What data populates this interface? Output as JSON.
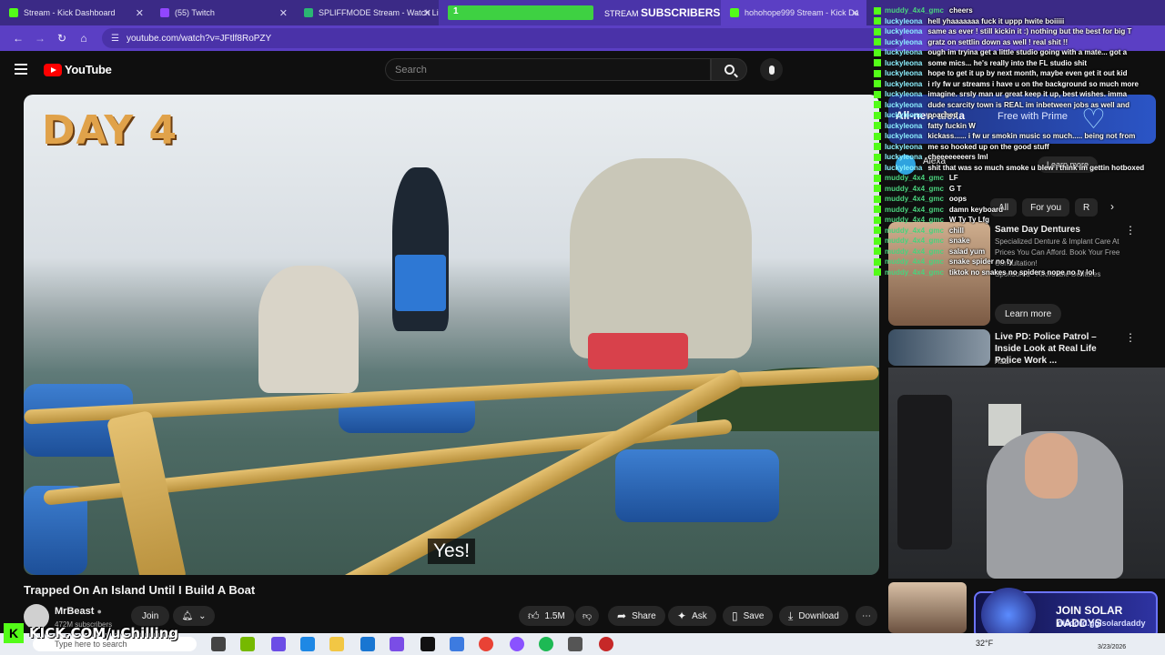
{
  "browser": {
    "tabs": [
      {
        "label": "Stream - Kick Dashboard",
        "icon": "kick-icon"
      },
      {
        "label": "(55) Twitch",
        "icon": "twitch-icon"
      },
      {
        "label": "SPLIFFMODE Stream - Watch Li",
        "icon": "kick-icon"
      },
      {
        "label": "hohohope999 Stream - Kick Da",
        "icon": "kick-icon"
      }
    ],
    "url": "youtube.com/watch?v=JFtlf8RoPZY"
  },
  "youtube": {
    "logo_text": "YouTube",
    "search_placeholder": "Search"
  },
  "video": {
    "overlay_title": "DAY 4",
    "caption": "Yes!",
    "title": "Trapped On An Island Until I Build A Boat",
    "channel": "MrBeast",
    "subscribers": "472M subscribers",
    "join": "Join",
    "likes": "1.5M",
    "actions": {
      "share": "Share",
      "ask": "Ask",
      "save": "Save",
      "download": "Download"
    }
  },
  "sidebar": {
    "ad": {
      "headline": "All-new alexa",
      "tagline": "Free with Prime"
    },
    "alexa_label": "Alexa",
    "alexa_learn": "Learn more",
    "chips": [
      "All",
      "For you",
      "R"
    ],
    "sponsored": {
      "title": "Same Day Dentures",
      "desc": "Specialized Denture & Implant Care At Prices You Can Afford. Book Your Free Consultation!",
      "sponsor": "Sponsored · Affordable Dentures",
      "learn": "Learn more"
    },
    "rec": {
      "title": "Live PD: Police Patrol – Inside Look at Real Life Police Work ...",
      "channel": "A&E"
    }
  },
  "chat": [
    {
      "user": "muddy_4x4_gmc",
      "msg": "cheers",
      "cls": "muddy"
    },
    {
      "user": "luckyleona",
      "msg": "hell yhaaaaaaa fuck it uppp hwite boiiiii",
      "cls": ""
    },
    {
      "user": "luckyleona",
      "msg": "same as ever ! still kickin it :) nothing but the best for big T",
      "cls": ""
    },
    {
      "user": "luckyleona",
      "msg": "gratz on settlin down as well ! real shit !!",
      "cls": ""
    },
    {
      "user": "luckyleona",
      "msg": "ough im tryina get a little studio going with a mate... got a",
      "cls": ""
    },
    {
      "user": "luckyleona",
      "msg": "some mics... he's really into the FL studio shit",
      "cls": ""
    },
    {
      "user": "luckyleona",
      "msg": "hope to get it up by next month, maybe even get it out kid",
      "cls": ""
    },
    {
      "user": "luckyleona",
      "msg": "i rly fw ur streams i have u on the background so much more",
      "cls": ""
    },
    {
      "user": "luckyleona",
      "msg": "imagine. srsly man ur great keep it up, best wishes. imma",
      "cls": ""
    },
    {
      "user": "luckyleona",
      "msg": "dude scarcity town is REAL im inbetween jobs as well and",
      "cls": ""
    },
    {
      "user": "luckyleona",
      "msg": "poached",
      "cls": ""
    },
    {
      "user": "luckyleona",
      "msg": "fatty fuckin W",
      "cls": ""
    },
    {
      "user": "luckyleona",
      "msg": "kickass...... i fw ur smokin music so much..... being not from",
      "cls": ""
    },
    {
      "user": "luckyleona",
      "msg": "me so hooked up on the good stuff",
      "cls": ""
    },
    {
      "user": "luckyleona",
      "msg": "cheeeeeeeers lml",
      "cls": ""
    },
    {
      "user": "luckyleona",
      "msg": "shit that was so much smoke u blew i think im gettin hotboxed",
      "cls": ""
    },
    {
      "user": "muddy_4x4_gmc",
      "msg": "LF",
      "cls": "muddy"
    },
    {
      "user": "muddy_4x4_gmc",
      "msg": "G T",
      "cls": "muddy"
    },
    {
      "user": "muddy_4x4_gmc",
      "msg": "oops",
      "cls": "muddy"
    },
    {
      "user": "muddy_4x4_gmc",
      "msg": "damn keyboard",
      "cls": "muddy"
    },
    {
      "user": "muddy_4x4_gmc",
      "msg": "W Ty Ty Lfg",
      "cls": "muddy"
    },
    {
      "user": "muddy_4x4_gmc",
      "msg": "chill",
      "cls": "muddy"
    },
    {
      "user": "muddy_4x4_gmc",
      "msg": "snake",
      "cls": "muddy"
    },
    {
      "user": "muddy_4x4_gmc",
      "msg": "salad yum",
      "cls": "muddy"
    },
    {
      "user": "muddy_4x4_gmc",
      "msg": "snake spider no ty",
      "cls": "muddy"
    },
    {
      "user": "muddy_4x4_gmc",
      "msg": "tiktok no snakes no spiders nope no ty lol",
      "cls": "muddy"
    }
  ],
  "overlays": {
    "sub_count": "1",
    "sub_label_small": "STREAM",
    "sub_label_big": "SUBSCRIBERS",
    "kick_url": "KICK.COM/uChilling",
    "solar_title": "JOIN SOLAR DADDYS",
    "solar_link": "discord.gg/solardaddy"
  },
  "taskbar": {
    "search_placeholder": "Type here to search",
    "temp": "32°F",
    "date": "3/23/2026"
  }
}
